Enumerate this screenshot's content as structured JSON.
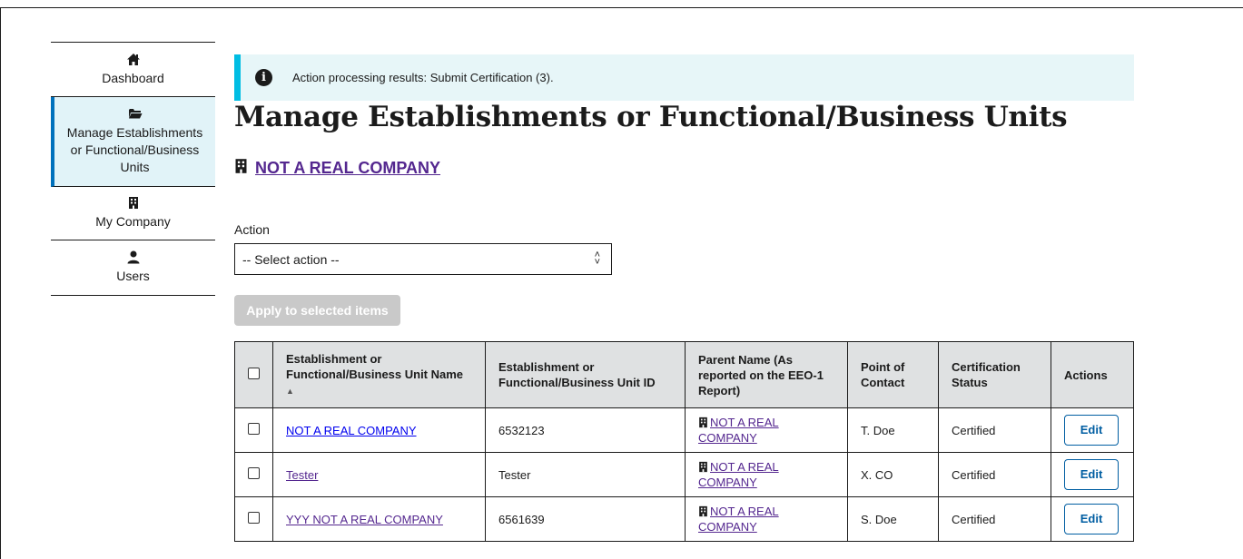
{
  "sidebar": {
    "items": [
      {
        "label": "Dashboard",
        "icon": "home-icon"
      },
      {
        "label": "Manage Establishments or Functional/Business Units",
        "icon": "folder-open-icon",
        "active": true
      },
      {
        "label": "My Company",
        "icon": "building-icon"
      },
      {
        "label": "Users",
        "icon": "user-icon"
      }
    ]
  },
  "alert": {
    "text": "Action processing results: Submit Certification (3)."
  },
  "page": {
    "title": "Manage Establishments or Functional/Business Units",
    "company_link": "NOT A REAL COMPANY"
  },
  "action": {
    "label": "Action",
    "select_value": "-- Select action --",
    "apply_label": "Apply to selected items"
  },
  "table": {
    "headers": {
      "name": "Establishment or Functional/Business Unit Name",
      "id": "Establishment or Functional/Business Unit ID",
      "parent": "Parent Name (As reported on the EEO-1 Report)",
      "contact": "Point of Contact",
      "status": "Certification Status",
      "actions": "Actions"
    },
    "sort_indicator": "▲",
    "rows": [
      {
        "name": "NOT A REAL COMPANY",
        "id": "6532123",
        "parent": "NOT A REAL COMPANY",
        "contact": "T. Doe",
        "status": "Certified",
        "action": "Edit"
      },
      {
        "name": "Tester",
        "id": "Tester",
        "parent": "NOT A REAL COMPANY",
        "contact": "X. CO",
        "status": "Certified",
        "action": "Edit"
      },
      {
        "name": "YYY NOT A REAL COMPANY",
        "id": "6561639",
        "parent": "NOT A REAL COMPANY",
        "contact": "S. Doe",
        "status": "Certified",
        "action": "Edit"
      }
    ]
  },
  "colors": {
    "accent": "#005ea2",
    "alert_bg": "#e7f6f8",
    "alert_border": "#00bde3",
    "visited_link": "#54278f",
    "active_nav_bg": "#e1f3f8",
    "header_bg": "#dfe1e2"
  }
}
